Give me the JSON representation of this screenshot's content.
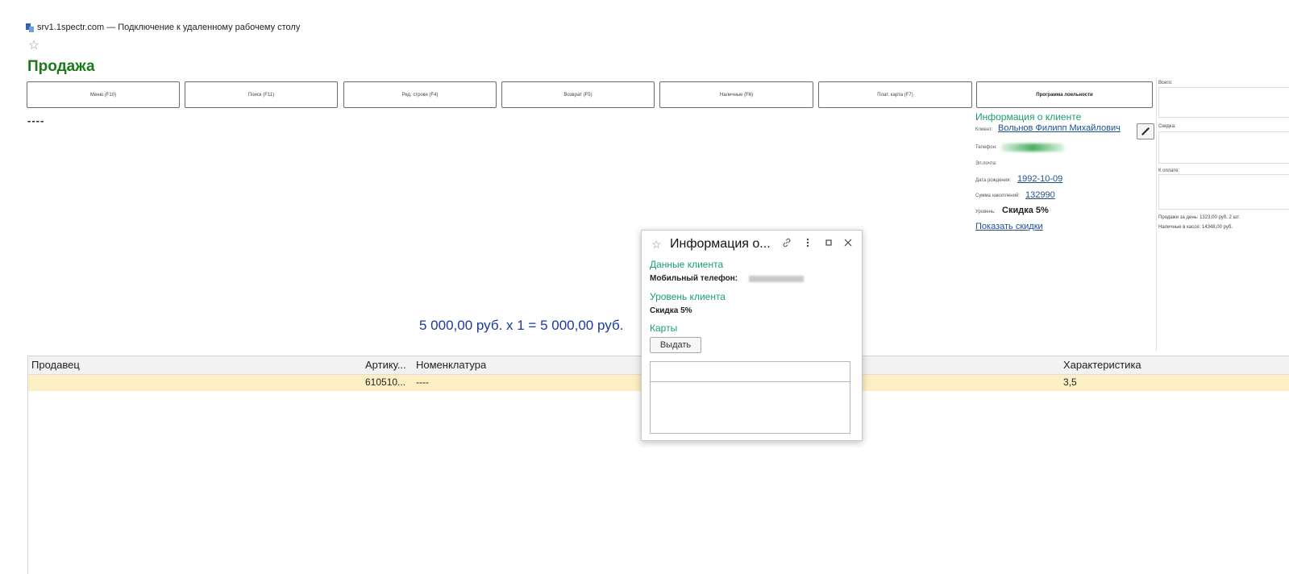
{
  "window": {
    "title": "srv1.1spectr.com — Подключение к удаленному рабочему столу"
  },
  "page": {
    "title": "Продажа",
    "dashes": "----"
  },
  "toolbar": [
    "Меню (F10)",
    "Поиск (F11)",
    "Ред. строки (F4)",
    "Возврат (F5)",
    "Наличные (F6)",
    "Плат. карта (F7)",
    "Программа лояльности"
  ],
  "client": {
    "section_title": "Информация о клиенте",
    "client_label": "Клиент:",
    "client_name": "Вольнов Филипп Михайлович",
    "phone_label": "Телефон:",
    "email_label": "Эл.почта:",
    "birth_label": "Дата рождения:",
    "birth_value": "1992-10-09",
    "sum_label": "Сумма накоплений:",
    "sum_value": "132990",
    "level_label": "Уровень:",
    "level_value": "Скидка 5%",
    "show_discounts": "Показать скидки"
  },
  "totals": {
    "total_label": "Всего:",
    "discount_label": "Скидка:",
    "to_pay_label": "К оплате:",
    "sales_day": "Продажи за день: 1323,00 руб. 2 шт.",
    "cash_in_register": "Наличные в кассе: 14348,00 руб."
  },
  "calc_line": "5 000,00 руб. х 1  = 5 000,00 руб.",
  "table": {
    "headers": {
      "seller": "Продавец",
      "article": "Артику...",
      "nomenclature": "Номенклатура",
      "characteristic": "Характеристика"
    },
    "rows": [
      {
        "seller": "",
        "article": "610510...",
        "nomenclature": "----",
        "characteristic": "3,5"
      }
    ]
  },
  "popup": {
    "title": "Информация о...",
    "client_data_title": "Данные клиента",
    "mobile_label": "Мобильный телефон:",
    "level_title": "Уровень клиента",
    "level_value": "Скидка 5%",
    "cards_title": "Карты",
    "issue_button": "Выдать"
  }
}
